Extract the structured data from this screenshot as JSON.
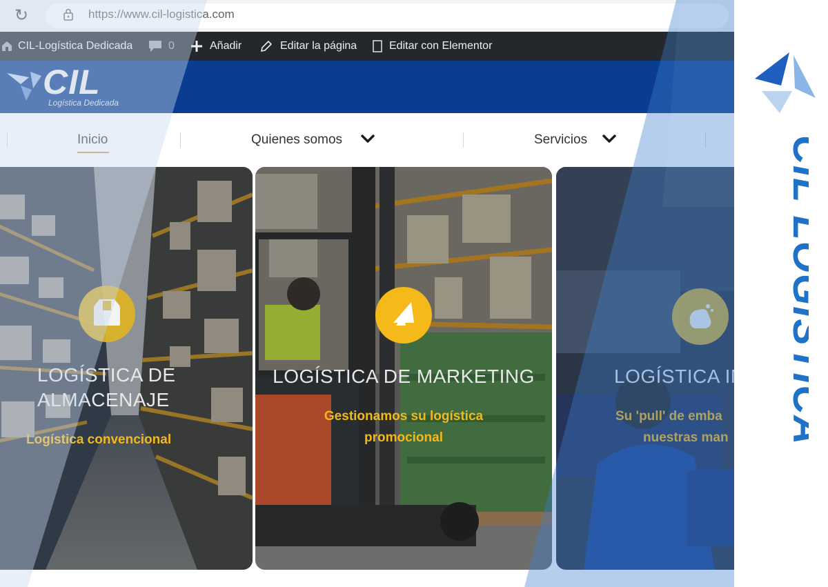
{
  "browser": {
    "url": "https://www.cil-logistica.com",
    "reload_glyph": "↻"
  },
  "admin_bar": {
    "site_name": "CIL-Logística Dedicada",
    "comments_count": "0",
    "add_label": "Añadir",
    "edit_page_label": "Editar la página",
    "edit_elementor_label": "Editar con Elementor",
    "icons": [
      "wordpress-site-icon",
      "comment-icon",
      "plus-icon",
      "pencil-icon",
      "elementor-icon"
    ]
  },
  "header": {
    "logo_word": "CIL",
    "logo_tagline": "Logística Dedicada",
    "brand_color": "#0a3d8f"
  },
  "nav": {
    "items": [
      {
        "label": "Inicio",
        "active": true
      },
      {
        "label": "Quienes somos",
        "has_dropdown": true
      },
      {
        "label": "Servicios",
        "has_dropdown": true
      }
    ],
    "active_underline_color": "#c7a35a"
  },
  "cards": [
    {
      "title_line1": "LOGÍSTICA DE",
      "title_line2": "ALMACENAJE",
      "subtitle_line1": "Logística convencional",
      "icon": "box-icon",
      "icon_color": "#e0b423"
    },
    {
      "title_line1": "LOGÍSTICA DE MARKETING",
      "subtitle_line1": "Gestionamos su logística",
      "subtitle_line2": "promocional",
      "icon": "megaphone-icon",
      "icon_color": "#f5b91a"
    },
    {
      "title_line1": "LOGÍSTICA INV",
      "subtitle_line1": "Su 'pull' de emba",
      "subtitle_line2": "nuestras man",
      "icon": "clean-hands-icon",
      "icon_color": "#d9b63a"
    }
  ],
  "side_brand": {
    "text": "CIL LOGISTICA",
    "color": "#1e73c8"
  },
  "accent_colors": {
    "subtitle_yellow": "#f2b91c",
    "overlay_blue": "#2d6fb8"
  }
}
